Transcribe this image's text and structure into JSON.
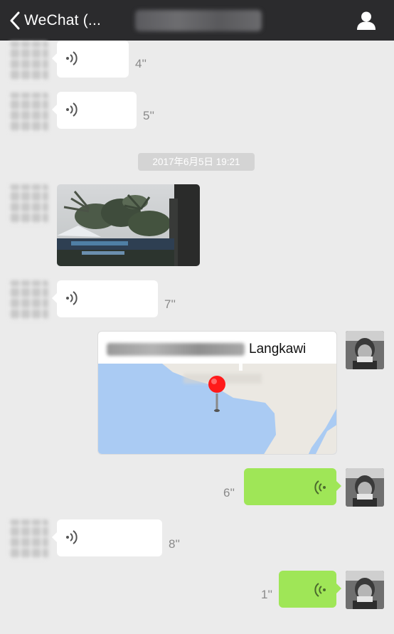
{
  "header": {
    "back_label": "WeChat (...",
    "icons": {
      "back": "chevron-left-icon",
      "profile": "person-icon"
    }
  },
  "messages": {
    "voice_1": {
      "duration": "4''"
    },
    "voice_2": {
      "duration": "5''"
    },
    "timestamp": "2017年6月5日 19:21",
    "voice_3": {
      "duration": "7''"
    },
    "location": {
      "name_visible": "Langkawi"
    },
    "voice_4": {
      "duration": "6''"
    },
    "voice_5": {
      "duration": "8''"
    },
    "voice_6": {
      "duration": "1''"
    }
  },
  "colors": {
    "header_bg": "#2b2b2d",
    "chat_bg": "#ebebeb",
    "sent_bubble": "#9fe657",
    "received_bubble": "#ffffff",
    "map_water": "#aacbf3",
    "map_land": "#ebe8e2",
    "pin": "#ff1a1a"
  }
}
